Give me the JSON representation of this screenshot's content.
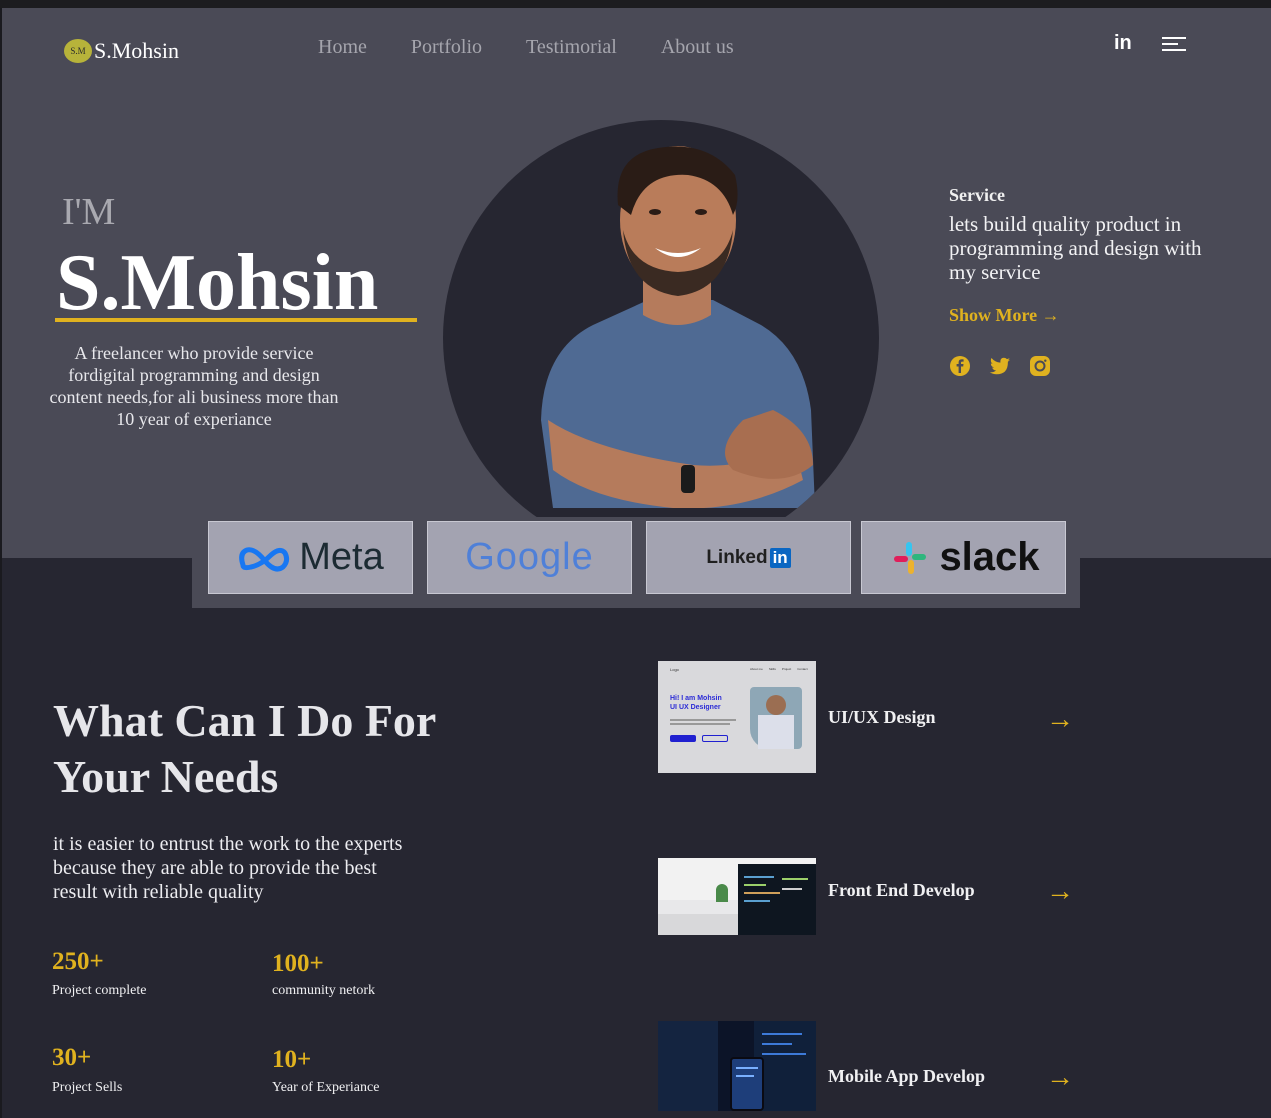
{
  "brand": {
    "badge": "S.M",
    "name": "S.Mohsin"
  },
  "nav": [
    "Home",
    "Portfolio",
    "Testimorial",
    "About us"
  ],
  "header_icons": {
    "linkedin": "in"
  },
  "hero": {
    "im": "I'M",
    "name": "S.Mohsin",
    "intro": "A freelancer who provide service fordigital programming and design content needs,for ali business more than 10 year of experiance"
  },
  "service": {
    "label": "Service",
    "text": "lets build quality product in programming and design with my service",
    "show_more": "Show More →"
  },
  "brands": [
    "Meta",
    "Google",
    "Linked",
    "in",
    "slack"
  ],
  "what": {
    "title": "What Can I Do For Your Needs",
    "text": "it is easier to entrust the work to the experts because they are able to provide the best result with reliable quality"
  },
  "stats": [
    {
      "value": "250+",
      "label": "Project complete"
    },
    {
      "value": "100+",
      "label": "community netork"
    },
    {
      "value": "30+",
      "label": "Project Sells"
    },
    {
      "value": "10+",
      "label": "Year of Experiance"
    }
  ],
  "services": [
    {
      "title": "UI/UX Design",
      "arrow": "→"
    },
    {
      "title": "Front End Develop",
      "arrow": "→"
    },
    {
      "title": "Mobile App Develop",
      "arrow": "→"
    }
  ],
  "mockup": {
    "logo": "Logo",
    "greeting": "Hi! I am Mohsin",
    "role": "UI UX Designer",
    "nav": [
      "About me",
      "Skills",
      "Project",
      "Contact"
    ]
  },
  "colors": {
    "accent": "#e0b21f",
    "hero_bg": "#4a4a56",
    "lower_bg": "#262631"
  }
}
